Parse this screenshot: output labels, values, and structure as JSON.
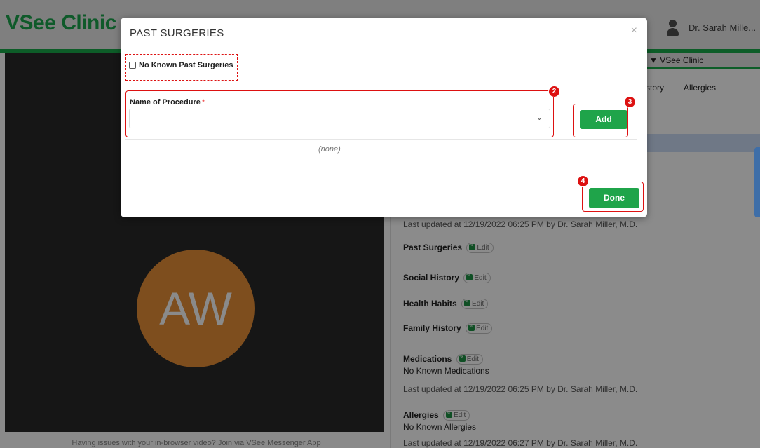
{
  "header": {
    "logo": "VSee Clinic",
    "user_name": "Dr. Sarah Mille...",
    "clinic_dropdown": "VSee Clinic"
  },
  "tabs": {
    "history_partial": "story",
    "allergies": "Allergies"
  },
  "video": {
    "avatar_initials": "AW",
    "issue_text": "Having issues with your in-browser video? Join via VSee Messenger App"
  },
  "panel": {
    "updated_1": "Last updated at 12/19/2022 06:25 PM by Dr. Sarah Miller, M.D.",
    "edit_label": "Edit",
    "past_surgeries": "Past Surgeries",
    "social_history": "Social History",
    "health_habits": "Health Habits",
    "family_history": "Family History",
    "medications": "Medications",
    "medications_value": "No Known Medications",
    "updated_2": "Last updated at 12/19/2022 06:25 PM by Dr. Sarah Miller, M.D.",
    "allergies": "Allergies",
    "allergies_value": "No Known Allergies",
    "updated_3": "Last updated at 12/19/2022 06:27 PM by Dr. Sarah Miller, M.D."
  },
  "modal": {
    "title": "PAST SURGERIES",
    "close_glyph": "×",
    "no_known_label": "No Known Past Surgeries",
    "procedure_label": "Name of Procedure",
    "required_mark": "*",
    "procedure_value": "",
    "chevron": "⌄",
    "empty_list": "(none)",
    "add_label": "Add",
    "done_label": "Done",
    "badges": [
      "2",
      "3",
      "4"
    ]
  },
  "colors": {
    "accent_green": "#1fa44a",
    "annotation_red": "#dd1111",
    "brand_green": "#0d5d28"
  }
}
